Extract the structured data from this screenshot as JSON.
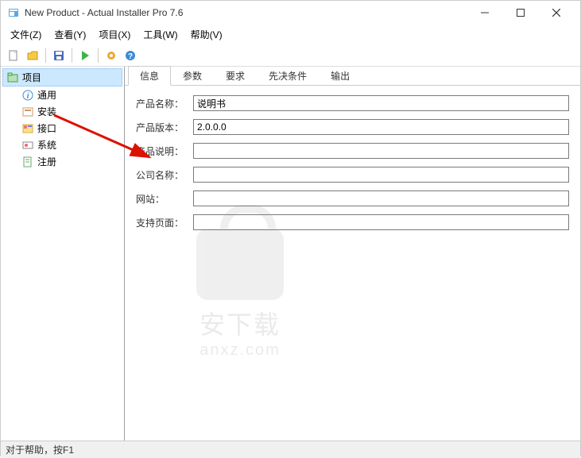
{
  "window": {
    "title": "New Product - Actual Installer Pro 7.6"
  },
  "menu": {
    "file": "文件(Z)",
    "view": "查看(Y)",
    "project": "项目(X)",
    "tools": "工具(W)",
    "help": "帮助(V)"
  },
  "sidebar": {
    "root": "项目",
    "general": "通用",
    "install": "安装",
    "interface": "接口",
    "system": "系统",
    "register": "注册"
  },
  "tabs": {
    "info": "信息",
    "params": "参数",
    "require": "要求",
    "precond": "先决条件",
    "output": "输出"
  },
  "form": {
    "product_name_label": "产品名称：",
    "product_name_value": "说明书",
    "product_version_label": "产品版本：",
    "product_version_value": "2.0.0.0",
    "product_desc_label": "产品说明：",
    "product_desc_value": "",
    "company_label": "公司名称：",
    "company_value": "",
    "website_label": "网站：",
    "website_value": "",
    "support_label": "支持页面：",
    "support_value": ""
  },
  "statusbar": {
    "text": "对于帮助，按F1"
  },
  "watermark": {
    "text": "安下载",
    "url": "anxz.com"
  }
}
